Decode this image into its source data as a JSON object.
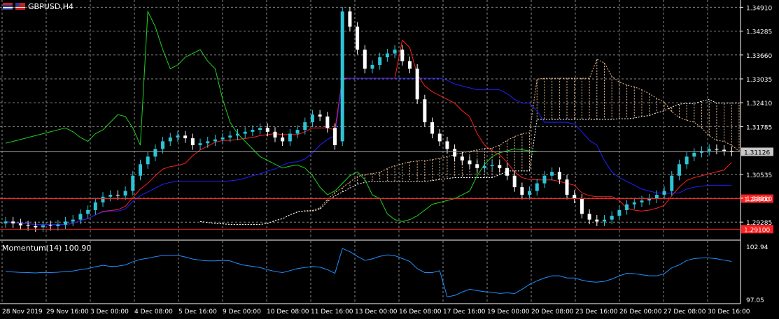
{
  "window": {
    "symbol_title": "GBPUSD,H4"
  },
  "indicator": {
    "title": "Momentum(14) 100.90"
  },
  "colors": {
    "background": "#000000",
    "grid": "#8a8a8a",
    "axis": "#ffffff",
    "bull_candle": "#2ec4d8",
    "bear_candle": "#ffffff",
    "tenkan": "#ff2020",
    "kijun": "#2020ff",
    "chikou": "#20d020",
    "senkou_a": "#f0c090",
    "senkou_b": "#ffffff",
    "momentum": "#1e90ff",
    "level_line": "#ff2020",
    "price_marker_bg": "#c8c8c8"
  },
  "chart_data": {
    "type": "candlestick",
    "price_axis_ticks": [
      "1.34910",
      "1.34285",
      "1.33660",
      "1.33035",
      "1.32410",
      "1.31785",
      "1.31126",
      "1.30535",
      "1.29910",
      "1.29285"
    ],
    "current_price": "1.31126",
    "levels": [
      "1.29900",
      "1.29100"
    ],
    "momentum_axis_ticks": [
      "102.94",
      "97.05"
    ],
    "time_labels": [
      "28 Nov 2019",
      "29 Nov 16:00",
      "3 Dec 00:00",
      "4 Dec 08:00",
      "5 Dec 16:00",
      "9 Dec 00:00",
      "10 Dec 08:00",
      "11 Dec 16:00",
      "13 Dec 00:00",
      "16 Dec 08:00",
      "17 Dec 16:00",
      "19 Dec 00:00",
      "20 Dec 08:00",
      "23 Dec 16:00",
      "26 Dec 00:00",
      "27 Dec 08:00",
      "30 Dec 16:00"
    ],
    "candles_close": [
      1.293,
      1.2925,
      1.292,
      1.2918,
      1.2915,
      1.292,
      1.2918,
      1.2922,
      1.293,
      1.2935,
      1.295,
      1.296,
      1.298,
      1.2995,
      1.3,
      1.2998,
      1.301,
      1.305,
      1.308,
      1.31,
      1.312,
      1.314,
      1.315,
      1.3155,
      1.3148,
      1.313,
      1.3135,
      1.314,
      1.3145,
      1.315,
      1.3155,
      1.316,
      1.3165,
      1.317,
      1.3175,
      1.3165,
      1.315,
      1.314,
      1.316,
      1.317,
      1.319,
      1.321,
      1.3205,
      1.3175,
      1.313,
      1.348,
      1.344,
      1.338,
      1.333,
      1.334,
      1.336,
      1.337,
      1.338,
      1.335,
      1.333,
      1.325,
      1.319,
      1.316,
      1.314,
      1.312,
      1.31,
      1.309,
      1.308,
      1.307,
      1.3075,
      1.3078,
      1.307,
      1.305,
      1.302,
      1.3,
      1.301,
      1.303,
      1.305,
      1.306,
      1.304,
      1.3,
      1.299,
      1.295,
      1.2935,
      1.293,
      1.2935,
      1.2945,
      1.296,
      1.2975,
      1.298,
      1.2985,
      1.299,
      1.3,
      1.301,
      1.305,
      1.308,
      1.31,
      1.311,
      1.3115,
      1.312,
      1.3118,
      1.3115,
      1.3113
    ]
  }
}
